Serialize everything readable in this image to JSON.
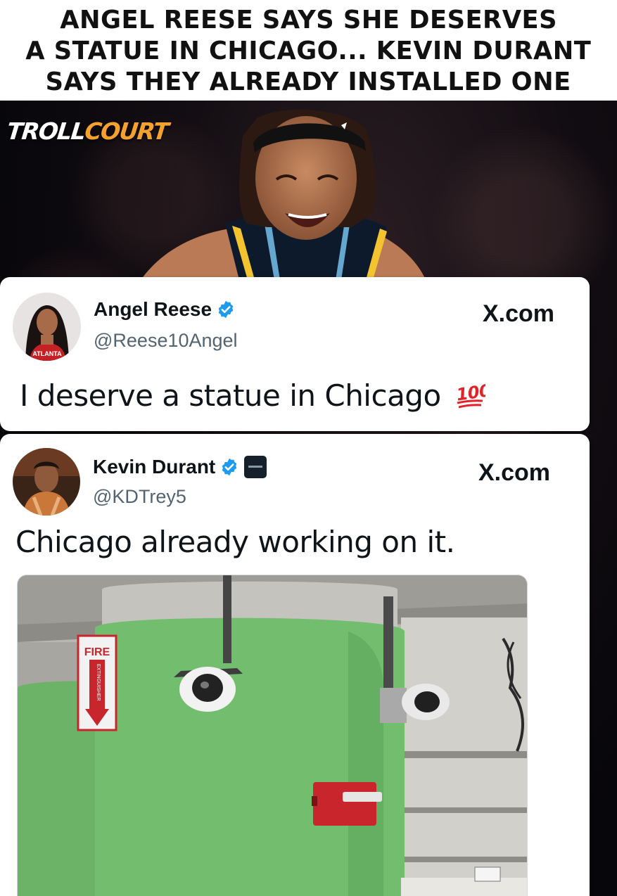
{
  "headline": {
    "lines": [
      "ANGEL REESE SAYS SHE DESERVES",
      "A STATUE IN CHICAGO... KEVIN DURANT",
      "SAYS THEY ALREADY INSTALLED ONE"
    ]
  },
  "brand": {
    "part1": "TROLL",
    "part2": "COURT",
    "accent": "#f4a12d"
  },
  "tweets": [
    {
      "display_name": "Angel Reese",
      "handle": "@Reese10Angel",
      "source": "X.com",
      "text": "I deserve a statue in Chicago",
      "emoji": "hundred-points-icon",
      "avatar_jersey_text": "ATLANTA",
      "verified": true
    },
    {
      "display_name": "Kevin Durant",
      "handle": "@KDTrey5",
      "source": "X.com",
      "text": "Chicago already working on it.",
      "verified": true,
      "affiliate_badge": true,
      "media": {
        "description_icon": "security-camera-icon",
        "sign_text": "FIRE",
        "sign_vertical_text": "EXTINGUISHER"
      }
    }
  ],
  "colors": {
    "verified_blue": "#1d9bf0",
    "pillar_green": "#6db86a",
    "sign_red": "#c8262c"
  }
}
